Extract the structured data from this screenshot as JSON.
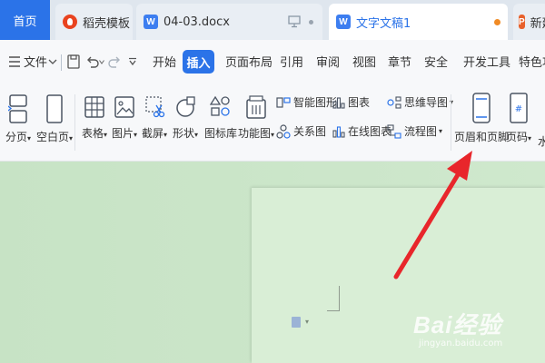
{
  "tabs": {
    "home": "首页",
    "templates": "稻壳模板",
    "doc": "04-03.docx",
    "active": "文字文稿1",
    "new": "新建"
  },
  "menu": {
    "file": "文件",
    "items": [
      "开始",
      "插入",
      "页面布局",
      "引用",
      "审阅",
      "视图",
      "章节",
      "安全",
      "开发工具",
      "特色功能"
    ]
  },
  "ribbon": {
    "page_break": "分页",
    "blank_page": "空白页",
    "table": "表格",
    "picture": "图片",
    "screenshot": "截屏",
    "shape": "形状",
    "icon_lib": "图标库",
    "func_chart": "功能图",
    "smart_art": "智能图形",
    "chart": "图表",
    "mind_map": "思维导图",
    "relation": "关系图",
    "online_chart": "在线图表",
    "flowchart": "流程图",
    "header_footer": "页眉和页脚",
    "page_number": "页码",
    "watermark": "水印"
  },
  "watermark_text": {
    "brand": "Bai经验",
    "url": "jingyan.baidu.com"
  },
  "colors": {
    "accent": "#2b73e8",
    "arrow": "#e8262b",
    "doc_bg": "#cfe8cd"
  }
}
